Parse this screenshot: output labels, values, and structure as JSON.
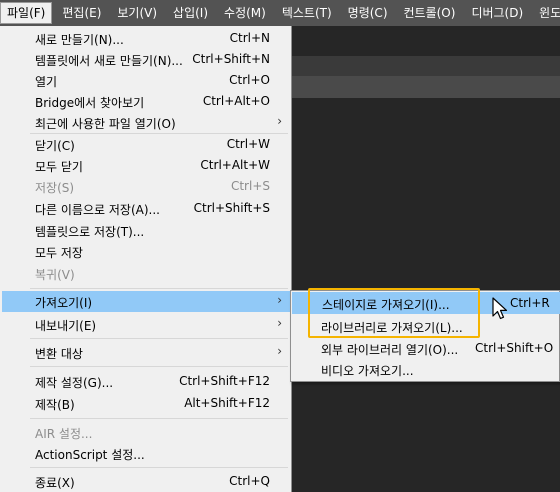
{
  "menubar": {
    "items": [
      "파일(F)",
      "편집(E)",
      "보기(V)",
      "삽입(I)",
      "수정(M)",
      "텍스트(T)",
      "명령(C)",
      "컨트롤(O)",
      "디버그(D)",
      "윈도"
    ]
  },
  "file_menu": {
    "items": [
      {
        "label": "새로 만들기(N)...",
        "shortcut": "Ctrl+N"
      },
      {
        "label": "템플릿에서 새로 만들기(N)...",
        "shortcut": "Ctrl+Shift+N"
      },
      {
        "label": "열기",
        "shortcut": "Ctrl+O"
      },
      {
        "label": "Bridge에서 찾아보기",
        "shortcut": "Ctrl+Alt+O"
      },
      {
        "label": "최근에 사용한 파일 열기(O)",
        "shortcut": ""
      },
      {
        "label": "닫기(C)",
        "shortcut": "Ctrl+W"
      },
      {
        "label": "모두 닫기",
        "shortcut": "Ctrl+Alt+W"
      },
      {
        "label": "저장(S)",
        "shortcut": "Ctrl+S"
      },
      {
        "label": "다른 이름으로 저장(A)...",
        "shortcut": "Ctrl+Shift+S"
      },
      {
        "label": "템플릿으로 저장(T)...",
        "shortcut": ""
      },
      {
        "label": "모두 저장",
        "shortcut": ""
      },
      {
        "label": "복귀(V)",
        "shortcut": ""
      },
      {
        "label": "가져오기(I)",
        "shortcut": ""
      },
      {
        "label": "내보내기(E)",
        "shortcut": ""
      },
      {
        "label": "변환 대상",
        "shortcut": ""
      },
      {
        "label": "제작 설정(G)...",
        "shortcut": "Ctrl+Shift+F12"
      },
      {
        "label": "제작(B)",
        "shortcut": "Alt+Shift+F12"
      },
      {
        "label": "AIR 설정...",
        "shortcut": ""
      },
      {
        "label": "ActionScript 설정...",
        "shortcut": ""
      },
      {
        "label": "종료(X)",
        "shortcut": "Ctrl+Q"
      }
    ],
    "arrow": "›"
  },
  "import_submenu": {
    "items": [
      {
        "label": "스테이지로 가져오기(I)...",
        "shortcut": "Ctrl+R"
      },
      {
        "label": "라이브러리로 가져오기(L)...",
        "shortcut": ""
      },
      {
        "label": "외부 라이브러리 열기(O)...",
        "shortcut": "Ctrl+Shift+O"
      },
      {
        "label": "비디오 가져오기...",
        "shortcut": ""
      }
    ]
  },
  "colors": {
    "menu_bg": "#f0f0f0",
    "hover_bg": "#91c9f7",
    "highlight_border": "#f5b400",
    "dark_bg": "#262626",
    "menubar_bg": "#535353"
  },
  "icons": [
    "submenu-arrow-icon",
    "mouse-cursor-icon"
  ]
}
